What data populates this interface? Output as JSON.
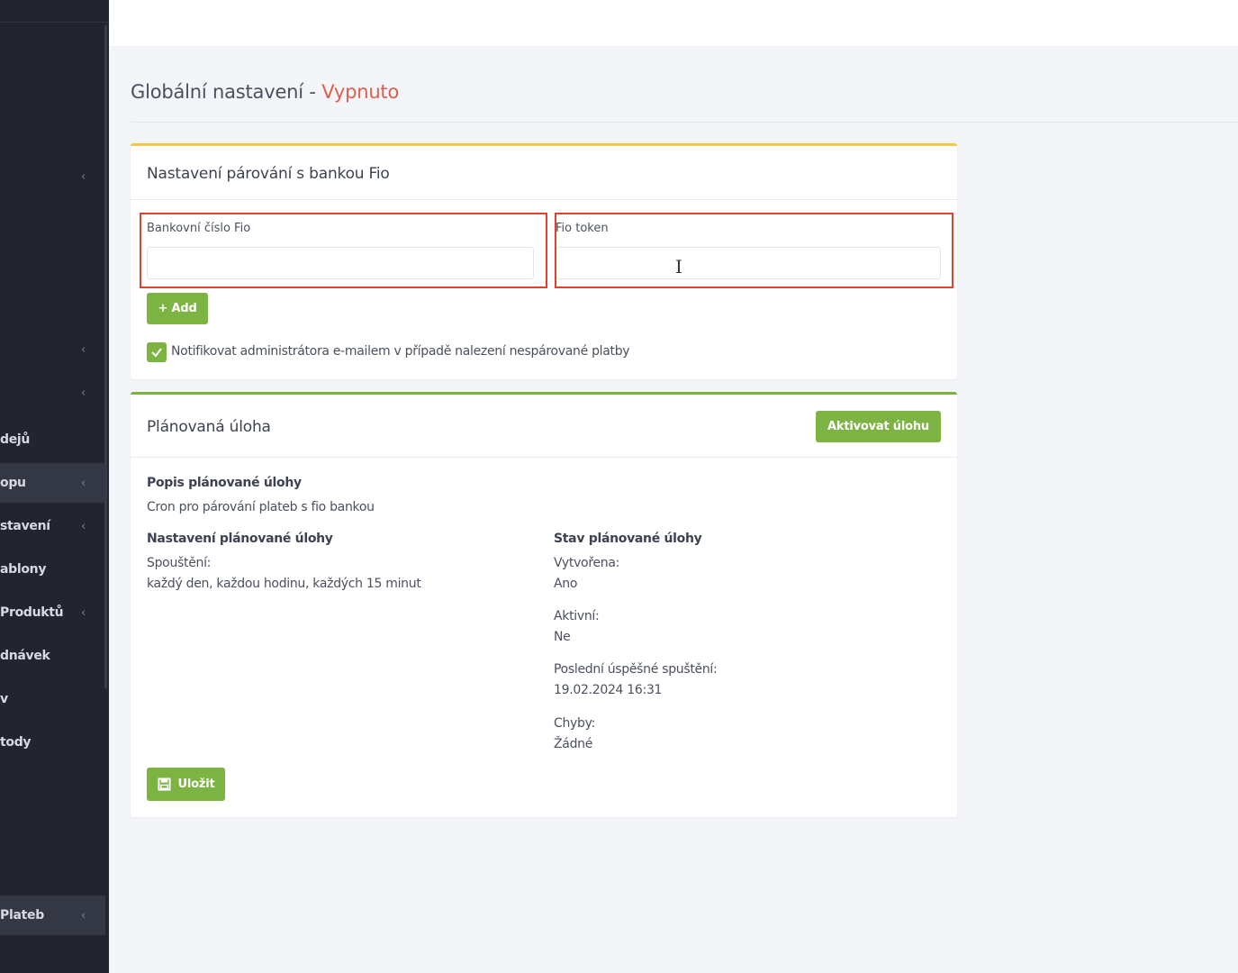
{
  "sidebar": {
    "items": [
      {
        "label": "dejů",
        "chevron": ""
      },
      {
        "label": "opu",
        "chevron": "‹"
      },
      {
        "label": "stavení",
        "chevron": "‹"
      },
      {
        "label": "ablony",
        "chevron": ""
      },
      {
        "label": "Produktů",
        "chevron": "‹"
      },
      {
        "label": "dnávek",
        "chevron": ""
      },
      {
        "label": "v",
        "chevron": ""
      },
      {
        "label": "tody",
        "chevron": ""
      },
      {
        "label": "Plateb",
        "chevron": "‹"
      }
    ],
    "chevron_glyph": "‹"
  },
  "page": {
    "title": "Globální nastavení - ",
    "state": "Vypnuto"
  },
  "fio_card": {
    "title": "Nastavení párování s bankou Fio",
    "bank_label": "Bankovní číslo Fio",
    "bank_value": "",
    "token_label": "Fio token",
    "token_value": "",
    "add_button": "+ Add",
    "notify_label": "Notifikovat administrátora e-mailem v případě nalezení nespárované platby",
    "notify_checked": true
  },
  "task_card": {
    "title": "Plánovaná úloha",
    "activate_button": "Aktivovat úlohu",
    "description_heading": "Popis plánované úlohy",
    "description": "Cron pro párování plateb s fio bankou",
    "settings_heading": "Nastavení plánované úlohy",
    "trigger_label": "Spouštění:",
    "trigger_value": "každý den, každou hodinu, každých 15 minut",
    "status_heading": "Stav plánované úlohy",
    "created_label": "Vytvořena:",
    "created_value": "Ano",
    "active_label": "Aktivní:",
    "active_value": "Ne",
    "last_run_label": "Poslední úspěšné spuštění:",
    "last_run_value": "19.02.2024 16:31",
    "errors_label": "Chyby:",
    "errors_value": "Žádné",
    "save_button": "Uložit"
  },
  "colors": {
    "accent_green": "#7cb342",
    "warning_yellow": "#f4c64a",
    "state_red": "#e05d4d",
    "highlight_red": "#e2412d",
    "sidebar_bg": "#22252f"
  }
}
